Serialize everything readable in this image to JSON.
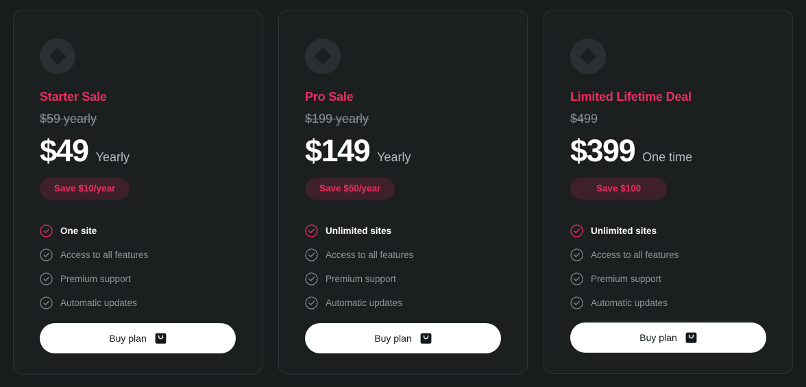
{
  "theme": {
    "page_background": "#181c1d",
    "card_background": "#1b1f20",
    "card_border": "#2d3234",
    "accent_pink": "#ec2d62",
    "badge_background": "#3d2029",
    "muted_text": "#8f989b",
    "price_text": "#ffffff",
    "button_background": "#ffffff",
    "button_text": "#13171a",
    "icon_circle": "#2b2f31",
    "check_inactive": "#8f989b"
  },
  "plans": [
    {
      "icon": "diamond-in-circle-icon",
      "title": "Starter Sale",
      "old_price": "$59 yearly",
      "price": "$49",
      "period": "Yearly",
      "badge": "Save $10/year",
      "badge_wide": false,
      "features": [
        {
          "label": "One site",
          "highlight": true
        },
        {
          "label": "Access to all features",
          "highlight": false
        },
        {
          "label": "Premium support",
          "highlight": false
        },
        {
          "label": "Automatic updates",
          "highlight": false
        }
      ],
      "cta_label": "Buy plan",
      "cta_icon": "shopping-bag-icon"
    },
    {
      "icon": "diamond-in-circle-icon",
      "title": "Pro Sale",
      "old_price": "$199 yearly",
      "price": "$149",
      "period": "Yearly",
      "badge": "Save $50/year",
      "badge_wide": false,
      "features": [
        {
          "label": "Unlimited sites",
          "highlight": true
        },
        {
          "label": "Access to all features",
          "highlight": false
        },
        {
          "label": "Premium support",
          "highlight": false
        },
        {
          "label": "Automatic updates",
          "highlight": false
        }
      ],
      "cta_label": "Buy plan",
      "cta_icon": "shopping-bag-icon"
    },
    {
      "icon": "diamond-in-circle-icon",
      "title": "Limited Lifetime Deal",
      "old_price": "$499",
      "price": "$399",
      "period": "One time",
      "badge": "Save $100",
      "badge_wide": true,
      "features": [
        {
          "label": "Unlimited sites",
          "highlight": true
        },
        {
          "label": "Access to all features",
          "highlight": false
        },
        {
          "label": "Premium support",
          "highlight": false
        },
        {
          "label": "Automatic updates",
          "highlight": false
        }
      ],
      "cta_label": "Buy plan",
      "cta_icon": "shopping-bag-icon"
    }
  ]
}
